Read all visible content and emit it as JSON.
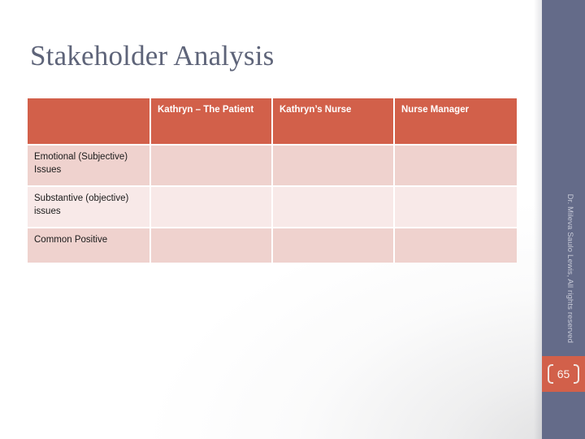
{
  "slide": {
    "title": "Stakeholder Analysis",
    "page_number": "65",
    "copyright": "Dr. Mileva Saulo Lewis, All rights reserved",
    "colors": {
      "accent_orange": "#D2604A",
      "sidebar_slate": "#646B89",
      "title_text": "#5E6479",
      "row_shade_dark": "#EFD2CE",
      "row_shade_light": "#F8E9E8",
      "canvas": "#FFFFFF"
    }
  },
  "table": {
    "columns": [
      {
        "label": ""
      },
      {
        "label": "Kathryn – The Patient"
      },
      {
        "label": "Kathryn’s Nurse"
      },
      {
        "label": "Nurse Manager"
      }
    ],
    "rows": [
      {
        "label": "Emotional (Subjective) Issues",
        "cells": [
          "",
          "",
          ""
        ]
      },
      {
        "label": "Substantive (objective) issues",
        "cells": [
          "",
          "",
          ""
        ]
      },
      {
        "label": "Common Positive",
        "cells": [
          "",
          "",
          ""
        ]
      }
    ]
  }
}
